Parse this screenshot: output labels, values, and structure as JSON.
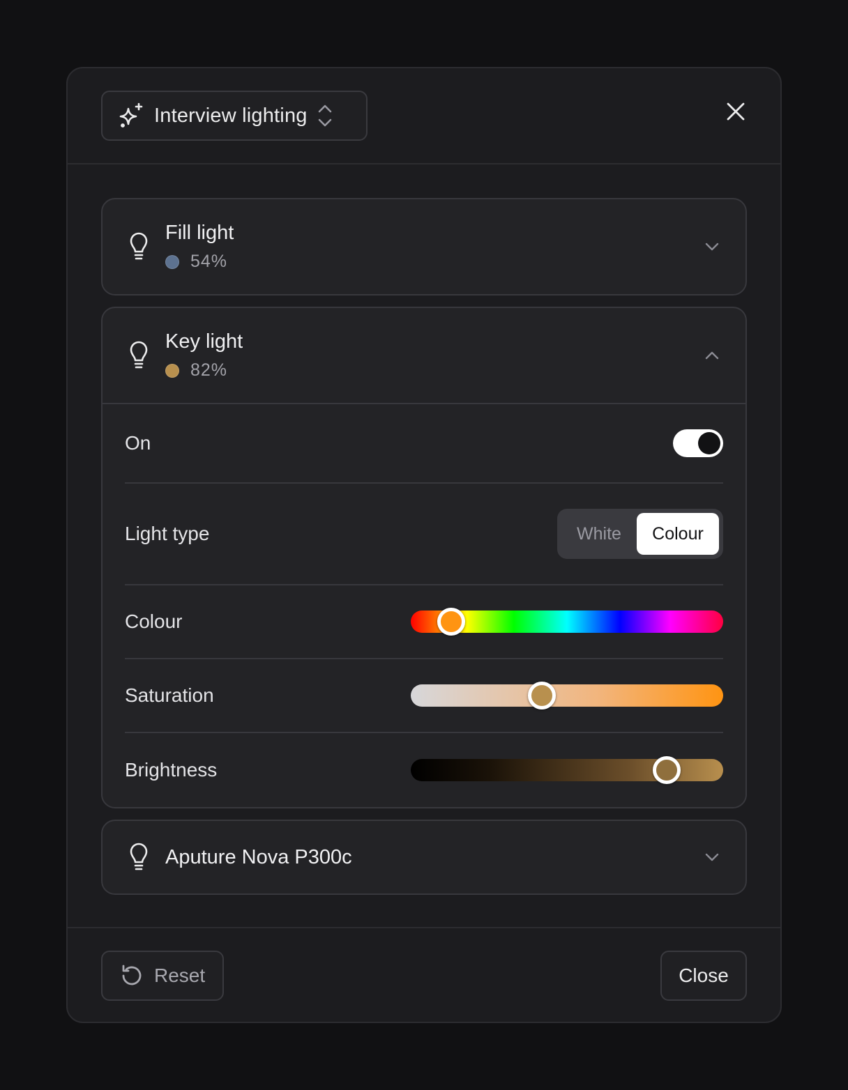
{
  "header": {
    "preset_label": "Interview lighting",
    "preset_icon": "sparkles-icon",
    "close_icon": "close-icon"
  },
  "lights": [
    {
      "name": "Fill light",
      "brightness_text": "54%",
      "color": "#5d7290",
      "expanded": false
    },
    {
      "name": "Key light",
      "brightness_text": "82%",
      "color": "#b8904e",
      "expanded": true,
      "controls": {
        "on_label": "On",
        "on_state": true,
        "light_type_label": "Light type",
        "light_type_options": [
          "White",
          "Colour"
        ],
        "light_type_selected": "Colour",
        "colour_label": "Colour",
        "colour_value": 0.13,
        "colour_thumb_color": "#ff9412",
        "saturation_label": "Saturation",
        "saturation_value": 0.42,
        "saturation_thumb_color": "#b8904e",
        "brightness_label": "Brightness",
        "brightness_value": 0.82,
        "brightness_thumb_color": "#8f6f3d"
      }
    },
    {
      "name": "Aputure Nova P300c",
      "expanded": false
    }
  ],
  "footer": {
    "reset_label": "Reset",
    "close_label": "Close"
  }
}
